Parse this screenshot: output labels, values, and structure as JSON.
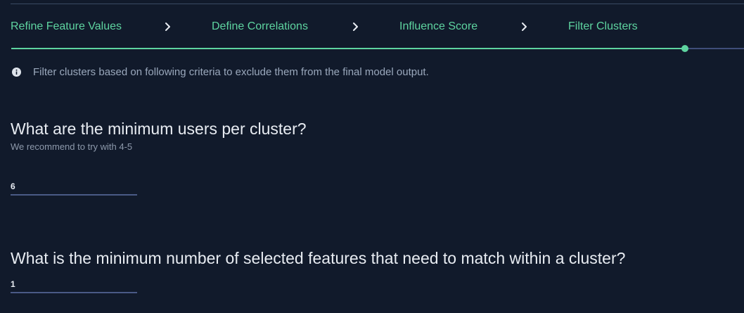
{
  "steps": [
    {
      "label": "Refine Feature Values"
    },
    {
      "label": "Define Correlations"
    },
    {
      "label": "Influence Score"
    },
    {
      "label": "Filter Clusters"
    }
  ],
  "progress": {
    "completed_fraction": 0.92,
    "current_step": 4
  },
  "info": {
    "icon": "info-icon",
    "text": "Filter clusters based on following criteria to exclude them from the final model output."
  },
  "question1": {
    "title": "What are the minimum users per cluster?",
    "subtitle": "We recommend to try with 4-5",
    "value": "6"
  },
  "question2": {
    "title": "What is the minimum number of selected features that need to match within a cluster?",
    "value": "1"
  },
  "colors": {
    "background": "#111a2b",
    "accent": "#5ed4a0",
    "text": "#e8ecf2",
    "muted": "#9aa8bc",
    "underline": "#4a5a86"
  }
}
